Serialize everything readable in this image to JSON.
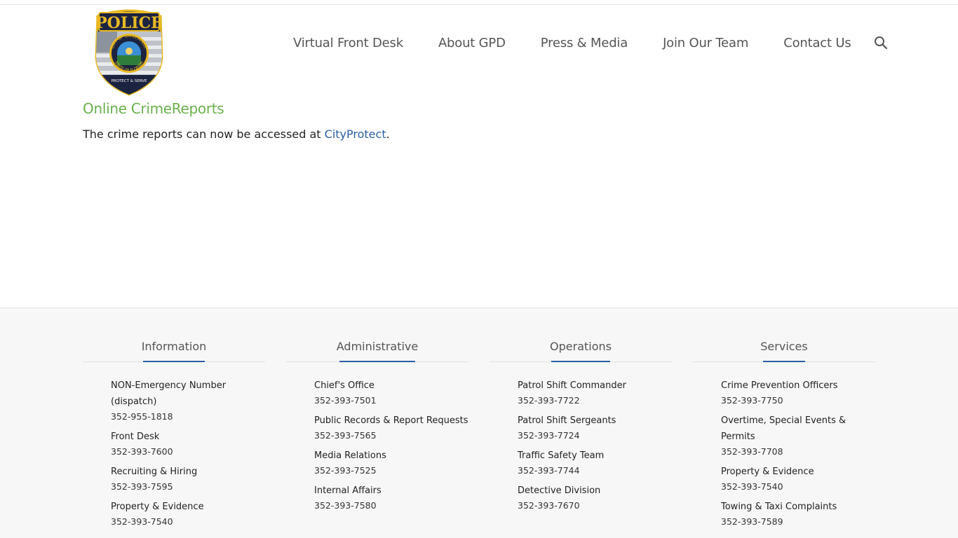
{
  "header": {
    "logo": {
      "top_text": "POLICE",
      "ring_top": "CITY OF GAINESVILLE",
      "ring_bottom": "STATE OF FLORIDA",
      "banner_text": "PROTECT & SERVE"
    },
    "nav": [
      "Virtual Front Desk",
      "About GPD",
      "Press & Media",
      "Join Our Team",
      "Contact Us"
    ],
    "search_icon": "search-icon"
  },
  "main": {
    "title": "Online CrimeReports",
    "text_before": "The crime reports can now be accessed at ",
    "link": "CityProtect",
    "text_after": "."
  },
  "footer": {
    "columns": [
      {
        "heading": "Information",
        "entries": [
          {
            "name": "NON-Emergency Number (dispatch)",
            "phone": "352-955-1818"
          },
          {
            "name": "Front Desk",
            "phone": "352-393-7600"
          },
          {
            "name": "Recruiting & Hiring",
            "phone": "352-393-7595"
          },
          {
            "name": "Property & Evidence",
            "phone": "352-393-7540"
          }
        ]
      },
      {
        "heading": "Administrative",
        "entries": [
          {
            "name": "Chief's Office",
            "phone": "352-393-7501"
          },
          {
            "name": "Public Records & Report Requests",
            "phone": "352-393-7565"
          },
          {
            "name": "Media Relations",
            "phone": "352-393-7525"
          },
          {
            "name": "Internal Affairs",
            "phone": "352-393-7580"
          }
        ]
      },
      {
        "heading": "Operations",
        "entries": [
          {
            "name": "Patrol Shift Commander",
            "phone": "352-393-7722"
          },
          {
            "name": "Patrol Shift Sergeants",
            "phone": "352-393-7724"
          },
          {
            "name": "Traffic Safety Team",
            "phone": "352-393-7744"
          },
          {
            "name": "Detective Division",
            "phone": "352-393-7670"
          }
        ]
      },
      {
        "heading": "Services",
        "entries": [
          {
            "name": "Crime Prevention Officers",
            "phone": "352-393-7750"
          },
          {
            "name": "Overtime, Special Events & Permits",
            "phone": "352-393-7708"
          },
          {
            "name": "Property & Evidence",
            "phone": "352-393-7540"
          },
          {
            "name": "Towing & Taxi Complaints",
            "phone": "352-393-7589"
          }
        ]
      }
    ]
  },
  "colors": {
    "title_green": "#6ab04c",
    "link_blue": "#2b5ea7",
    "nav_gray": "#555555",
    "footer_bg": "#f7f7f7",
    "badge_gold": "#e8b923",
    "badge_navy": "#1c2340"
  }
}
